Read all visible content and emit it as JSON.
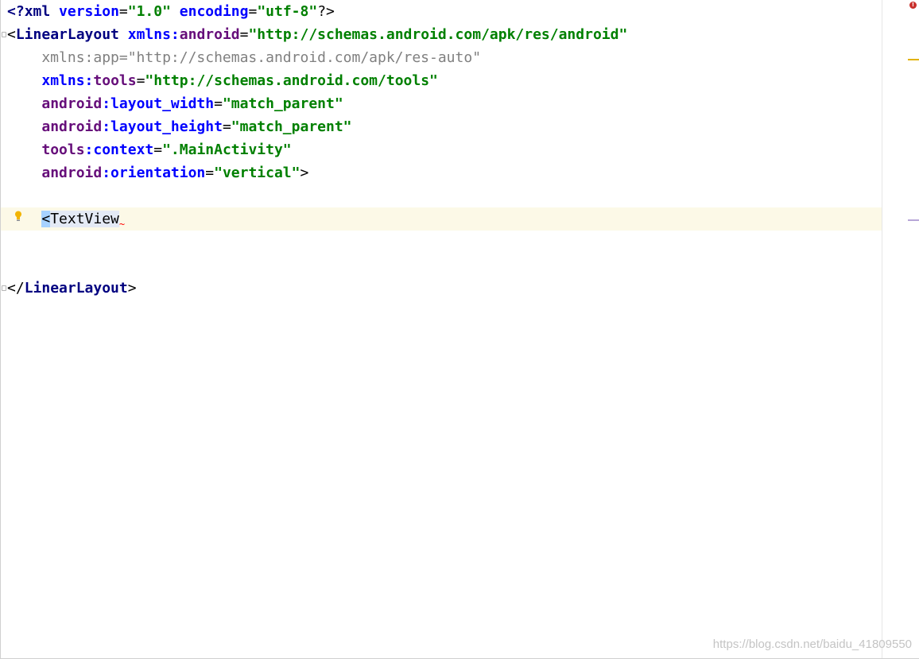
{
  "editor": {
    "lines": [
      {
        "segments": [
          [
            "<?",
            "tag"
          ],
          [
            "xml ",
            "tag"
          ],
          [
            "version",
            "attr"
          ],
          [
            "=",
            "br"
          ],
          [
            "\"1.0\"",
            "val"
          ],
          [
            " ",
            "br"
          ],
          [
            "encoding",
            "attr"
          ],
          [
            "=",
            "br"
          ],
          [
            "\"utf-8\"",
            "val"
          ],
          [
            "?>",
            "br"
          ]
        ]
      },
      {
        "segments": [
          [
            "<",
            "br"
          ],
          [
            "LinearLayout ",
            "tag"
          ],
          [
            "xmlns:",
            "attr"
          ],
          [
            "android",
            "ns"
          ],
          [
            "=",
            "br"
          ],
          [
            "\"http://schemas.android.com/apk/res/android\"",
            "val"
          ]
        ]
      },
      {
        "segments": [
          [
            "    xmlns:app=\"http://schemas.android.com/apk/res-auto\"",
            "gray"
          ]
        ]
      },
      {
        "segments": [
          [
            "    ",
            "br"
          ],
          [
            "xmlns:",
            "attr"
          ],
          [
            "tools",
            "ns"
          ],
          [
            "=",
            "br"
          ],
          [
            "\"http://schemas.android.com/tools\"",
            "val"
          ]
        ]
      },
      {
        "segments": [
          [
            "    ",
            "br"
          ],
          [
            "android",
            "ns"
          ],
          [
            ":layout_width",
            "attr"
          ],
          [
            "=",
            "br"
          ],
          [
            "\"match_parent\"",
            "val"
          ]
        ]
      },
      {
        "segments": [
          [
            "    ",
            "br"
          ],
          [
            "android",
            "ns"
          ],
          [
            ":layout_height",
            "attr"
          ],
          [
            "=",
            "br"
          ],
          [
            "\"match_parent\"",
            "val"
          ]
        ]
      },
      {
        "segments": [
          [
            "    ",
            "br"
          ],
          [
            "tools",
            "ns"
          ],
          [
            ":context",
            "attr"
          ],
          [
            "=",
            "br"
          ],
          [
            "\".MainActivity\"",
            "val"
          ]
        ]
      },
      {
        "segments": [
          [
            "    ",
            "br"
          ],
          [
            "android",
            "ns"
          ],
          [
            ":orientation",
            "attr"
          ],
          [
            "=",
            "br"
          ],
          [
            "\"vertical\"",
            "val"
          ],
          [
            ">",
            "br"
          ]
        ]
      },
      {
        "segments": []
      },
      {
        "segments": [
          [
            "    ",
            "br"
          ],
          [
            "<",
            "sel"
          ],
          [
            "TextView",
            "sel2"
          ]
        ],
        "caret": true
      },
      {
        "segments": []
      },
      {
        "segments": []
      },
      {
        "segments": [
          [
            "</",
            "br"
          ],
          [
            "LinearLayout",
            "tag"
          ],
          [
            ">",
            "br"
          ]
        ]
      }
    ]
  },
  "colors": {
    "tag": "#000080",
    "attribute": "#0000ff",
    "namespace": "#660e7a",
    "value": "#008000",
    "unused": "#808080",
    "caret_line": "#fcf9e7"
  },
  "gutter": {
    "intention_icon": "lightbulb-icon"
  },
  "stripe": {
    "error_icon": "error-icon",
    "error_glyph": "!"
  },
  "watermark": "https://blog.csdn.net/baidu_41809550"
}
